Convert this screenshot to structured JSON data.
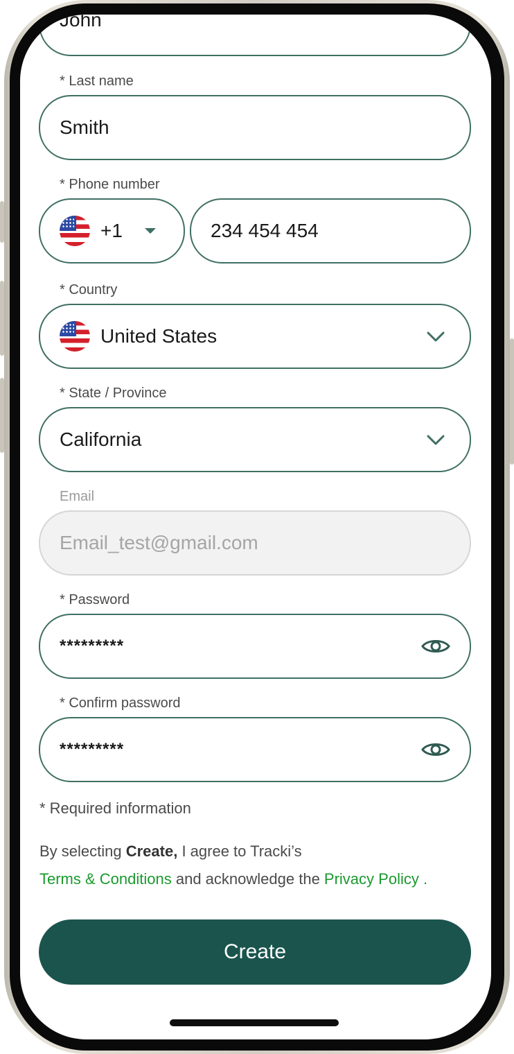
{
  "form": {
    "first_name_value": "John",
    "last_name": {
      "label": "* Last name",
      "value": "Smith"
    },
    "phone": {
      "label": "* Phone number",
      "country_code": "+1",
      "value": "234 454 454",
      "flag_icon": "us-flag-icon"
    },
    "country": {
      "label": "* Country",
      "value": "United States",
      "flag_icon": "us-flag-icon"
    },
    "state": {
      "label": "* State / Province",
      "value": "California"
    },
    "email": {
      "label": "Email",
      "placeholder": "Email_test@gmail.com"
    },
    "password": {
      "label": "* Password",
      "value": "*********"
    },
    "confirm_password": {
      "label": "* Confirm password",
      "value": "*********"
    },
    "required_note": "* Required information",
    "consent": {
      "prefix": "By selecting ",
      "bold": "Create,",
      "middle": " I agree to Tracki’s",
      "terms_link": "Terms & Conditions",
      "connector": " and acknowledge the ",
      "privacy_link": "Privacy Policy .",
      "link_color": "#1a9a2e"
    },
    "create_button": "Create"
  },
  "theme": {
    "accent": "#1a544d",
    "border": "#3f6f63"
  }
}
